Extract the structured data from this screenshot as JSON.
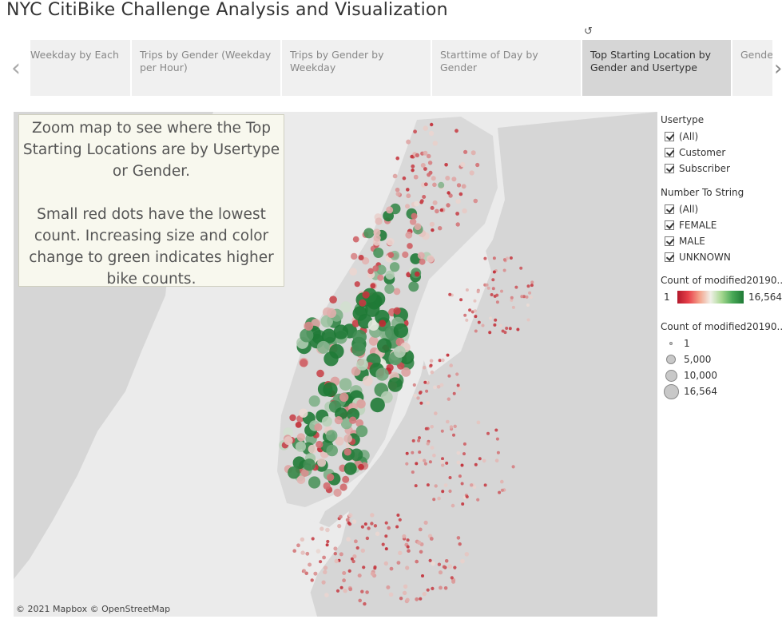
{
  "header": {
    "title": "NYC CitiBike Challenge Analysis and Visualization",
    "reset_icon": "revert-icon"
  },
  "tabs": [
    {
      "label": "Weekday by Each",
      "active": false
    },
    {
      "label": "Trips by Gender (Weekday per Hour)",
      "active": false
    },
    {
      "label": "Trips by Gender by Weekday",
      "active": false
    },
    {
      "label": "Starttime of Day by Gender",
      "active": false
    },
    {
      "label": "Top Starting Location by Gender and Usertype",
      "active": true
    },
    {
      "label": "Gender",
      "active": false
    }
  ],
  "map": {
    "note": [
      "Zoom map to see where the Top Starting Locations are by Usertype or Gender.",
      "Small red dots have the lowest count. Increasing size and color change to green indicates higher bike counts."
    ],
    "attribution": "© 2021 Mapbox © OpenStreetMap",
    "colors": {
      "low": "#c0252f",
      "mid": "#f0f0e8",
      "high": "#1f7a36"
    }
  },
  "filters": {
    "usertype": {
      "title": "Usertype",
      "options": [
        "(All)",
        "Customer",
        "Subscriber"
      ]
    },
    "gender": {
      "title": "Number To String",
      "options": [
        "(All)",
        "FEMALE",
        "MALE",
        "UNKNOWN"
      ]
    }
  },
  "color_legend": {
    "title": "Count of modified20190...",
    "min": "1",
    "max": "16,564"
  },
  "size_legend": {
    "title": "Count of modified20190...",
    "items": [
      {
        "label": "1",
        "value": 1
      },
      {
        "label": "5,000",
        "value": 5000
      },
      {
        "label": "10,000",
        "value": 10000
      },
      {
        "label": "16,564",
        "value": 16564
      }
    ]
  }
}
